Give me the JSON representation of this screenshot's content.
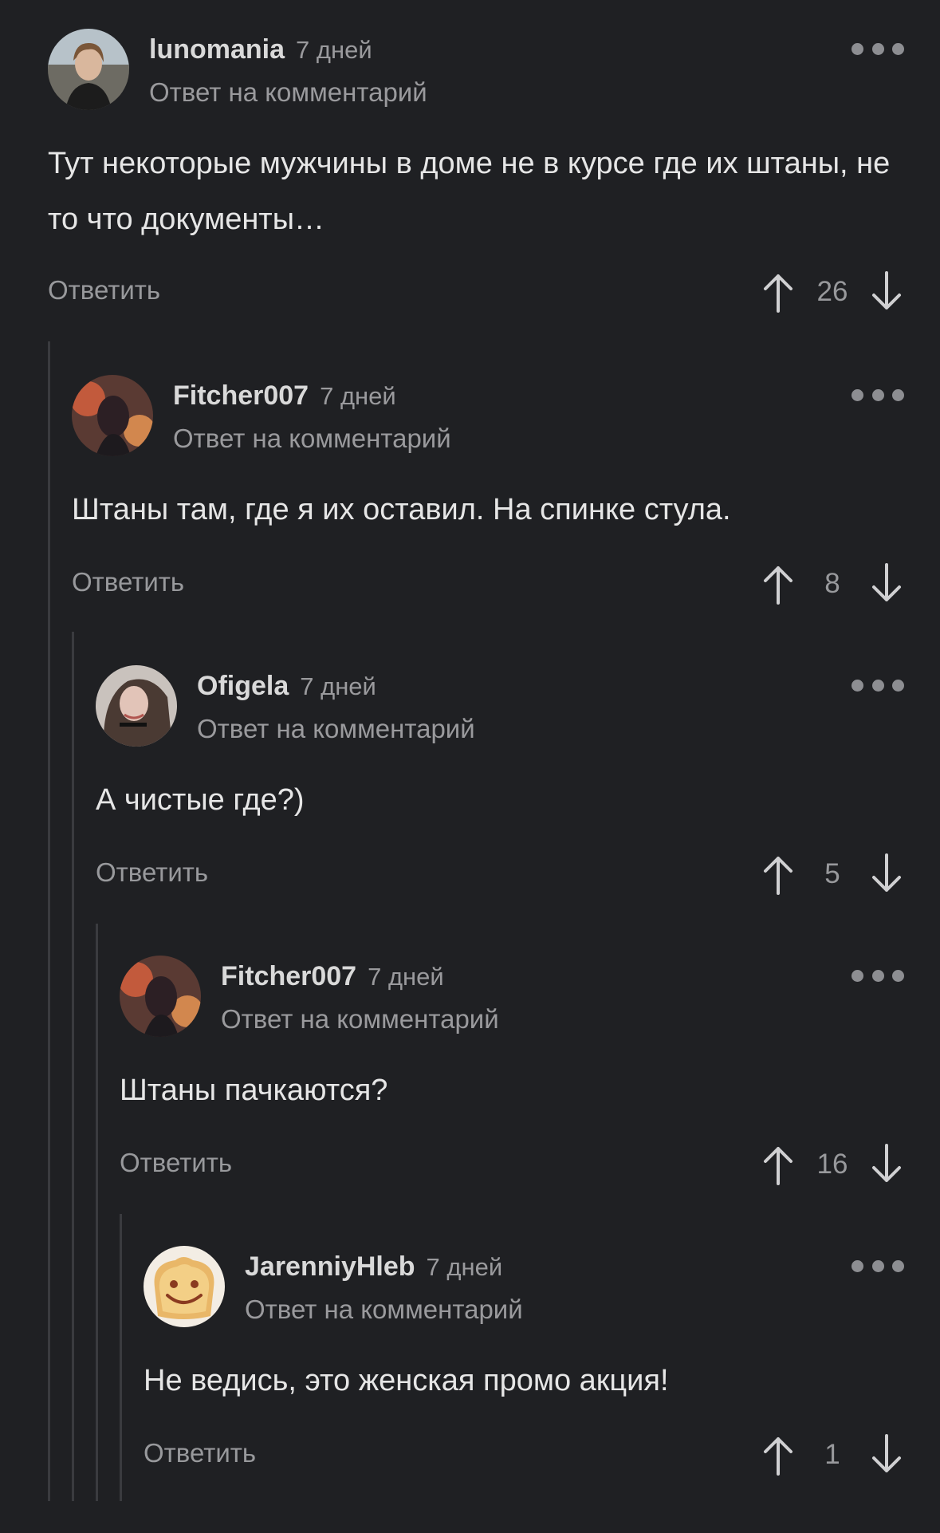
{
  "comments": [
    {
      "username": "lunomania",
      "time": "7 дней",
      "reply_to": "Ответ на комментарий",
      "text": "Тут некоторые мужчины в доме не в курсе где их штаны, не то что документы…",
      "reply_label": "Ответить",
      "score": "26"
    },
    {
      "username": "Fitcher007",
      "time": "7 дней",
      "reply_to": "Ответ на комментарий",
      "text": "Штаны там, где я их оставил. На спинке стула.",
      "reply_label": "Ответить",
      "score": "8"
    },
    {
      "username": "Ofigela",
      "time": "7 дней",
      "reply_to": "Ответ на комментарий",
      "text": "А чистые где?)",
      "reply_label": "Ответить",
      "score": "5"
    },
    {
      "username": "Fitcher007",
      "time": "7 дней",
      "reply_to": "Ответ на комментарий",
      "text": "Штаны пачкаются?",
      "reply_label": "Ответить",
      "score": "16"
    },
    {
      "username": "JarenniyHleb",
      "time": "7 дней",
      "reply_to": "Ответ на комментарий",
      "text": "Не ведись, это женская промо акция!",
      "reply_label": "Ответить",
      "score": "1"
    }
  ],
  "icons": {
    "more": "more-dots-icon",
    "upvote": "arrow-up-icon",
    "downvote": "arrow-down-icon"
  },
  "colors": {
    "background": "#1f2023",
    "text": "#e6e6e6",
    "muted": "#98999c",
    "thread_line": "#3a3b3f"
  }
}
